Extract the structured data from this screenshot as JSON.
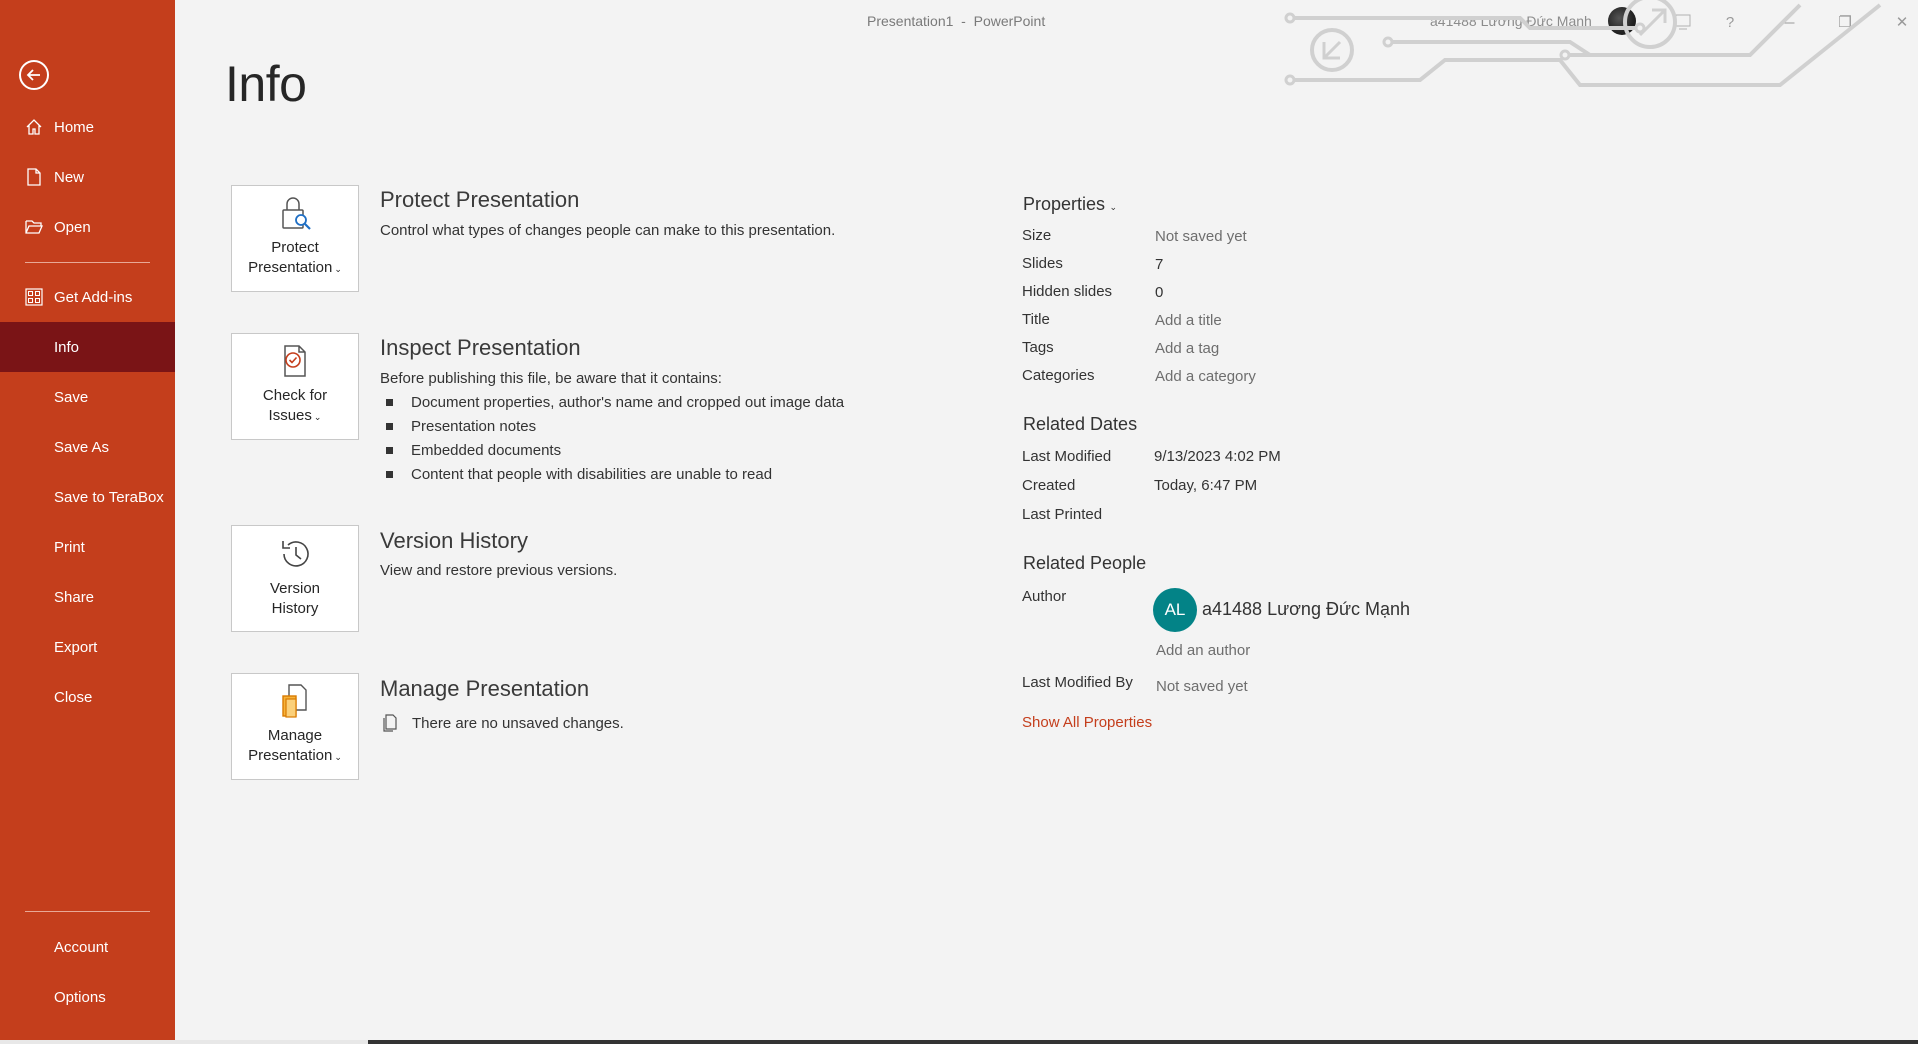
{
  "window": {
    "title": "Presentation1  -  PowerPoint",
    "user": "a41488 Lương Đức Mạnh",
    "help_symbol": "?",
    "minimize_symbol": "—",
    "restore_symbol": "❐",
    "close_symbol": "✕"
  },
  "sidebar": {
    "accent": "#c43e1c",
    "active_bg": "#7a1416",
    "items": [
      {
        "label": "Home",
        "icon": "home-icon"
      },
      {
        "label": "New",
        "icon": "new-document-icon"
      },
      {
        "label": "Open",
        "icon": "folder-open-icon"
      },
      {
        "label": "Get Add-ins",
        "icon": "add-ins-grid-icon"
      },
      {
        "label": "Info",
        "active": true
      },
      {
        "label": "Save"
      },
      {
        "label": "Save As"
      },
      {
        "label": "Save to TeraBox"
      },
      {
        "label": "Print"
      },
      {
        "label": "Share"
      },
      {
        "label": "Export"
      },
      {
        "label": "Close"
      }
    ],
    "bottom_items": [
      {
        "label": "Account"
      },
      {
        "label": "Options"
      }
    ]
  },
  "page": {
    "title": "Info"
  },
  "sections": {
    "protect": {
      "tile_line1": "Protect",
      "tile_line2": "Presentation",
      "title": "Protect Presentation",
      "desc": "Control what types of changes people can make to this presentation."
    },
    "inspect": {
      "tile_line1": "Check for",
      "tile_line2": "Issues",
      "title": "Inspect Presentation",
      "desc": "Before publishing this file, be aware that it contains:",
      "bullets": [
        "Document properties, author's name and cropped out image data",
        "Presentation notes",
        "Embedded documents",
        "Content that people with disabilities are unable to read"
      ]
    },
    "version": {
      "tile_line1": "Version",
      "tile_line2": "History",
      "title": "Version History",
      "desc": "View and restore previous versions."
    },
    "manage": {
      "tile_line1": "Manage",
      "tile_line2": "Presentation",
      "title": "Manage Presentation",
      "desc": "There are no unsaved changes."
    }
  },
  "properties": {
    "header": "Properties",
    "rows": {
      "size": {
        "label": "Size",
        "value": "Not saved yet"
      },
      "slides": {
        "label": "Slides",
        "value": "7"
      },
      "hidden": {
        "label": "Hidden slides",
        "value": "0"
      },
      "title": {
        "label": "Title",
        "value": "Add a title"
      },
      "tags": {
        "label": "Tags",
        "value": "Add a tag"
      },
      "categories": {
        "label": "Categories",
        "value": "Add a category"
      }
    },
    "related_dates": {
      "header": "Related Dates",
      "last_modified": {
        "label": "Last Modified",
        "value": "9/13/2023 4:02 PM"
      },
      "created": {
        "label": "Created",
        "value": "Today, 6:47 PM"
      },
      "last_printed": {
        "label": "Last Printed",
        "value": ""
      }
    },
    "related_people": {
      "header": "Related People",
      "author_label": "Author",
      "author_initials": "AL",
      "author_name": "a41488 Lương Đức Mạnh",
      "avatar_color": "#038387",
      "add_author": "Add an author",
      "last_modified_by_label": "Last Modified By",
      "last_modified_by_value": "Not saved yet"
    },
    "show_all": "Show All Properties"
  }
}
